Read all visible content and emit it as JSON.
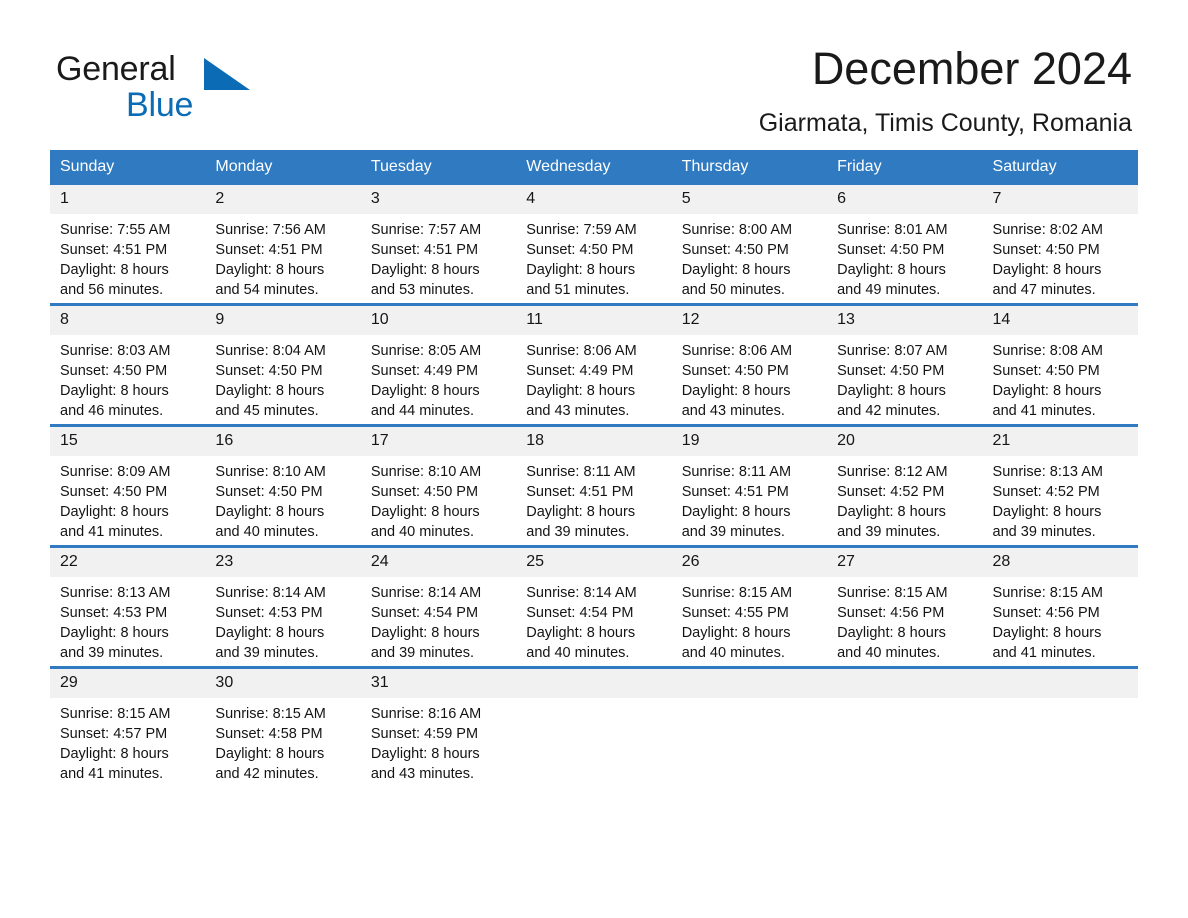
{
  "brand": {
    "name_part1": "General",
    "name_part2": "Blue",
    "flag_icon": "triangle-flag-icon"
  },
  "header": {
    "title": "December 2024",
    "subtitle": "Giarmata, Timis County, Romania"
  },
  "colors": {
    "header_blue": "#2f7ac0",
    "brand_blue": "#0b6cb5",
    "daynum_band": "#f1f1f1",
    "text": "#141414"
  },
  "weekday_headers": [
    "Sunday",
    "Monday",
    "Tuesday",
    "Wednesday",
    "Thursday",
    "Friday",
    "Saturday"
  ],
  "weeks": [
    [
      {
        "day": "1",
        "sunrise": "Sunrise: 7:55 AM",
        "sunset": "Sunset: 4:51 PM",
        "daylight_line1": "Daylight: 8 hours",
        "daylight_line2": "and 56 minutes."
      },
      {
        "day": "2",
        "sunrise": "Sunrise: 7:56 AM",
        "sunset": "Sunset: 4:51 PM",
        "daylight_line1": "Daylight: 8 hours",
        "daylight_line2": "and 54 minutes."
      },
      {
        "day": "3",
        "sunrise": "Sunrise: 7:57 AM",
        "sunset": "Sunset: 4:51 PM",
        "daylight_line1": "Daylight: 8 hours",
        "daylight_line2": "and 53 minutes."
      },
      {
        "day": "4",
        "sunrise": "Sunrise: 7:59 AM",
        "sunset": "Sunset: 4:50 PM",
        "daylight_line1": "Daylight: 8 hours",
        "daylight_line2": "and 51 minutes."
      },
      {
        "day": "5",
        "sunrise": "Sunrise: 8:00 AM",
        "sunset": "Sunset: 4:50 PM",
        "daylight_line1": "Daylight: 8 hours",
        "daylight_line2": "and 50 minutes."
      },
      {
        "day": "6",
        "sunrise": "Sunrise: 8:01 AM",
        "sunset": "Sunset: 4:50 PM",
        "daylight_line1": "Daylight: 8 hours",
        "daylight_line2": "and 49 minutes."
      },
      {
        "day": "7",
        "sunrise": "Sunrise: 8:02 AM",
        "sunset": "Sunset: 4:50 PM",
        "daylight_line1": "Daylight: 8 hours",
        "daylight_line2": "and 47 minutes."
      }
    ],
    [
      {
        "day": "8",
        "sunrise": "Sunrise: 8:03 AM",
        "sunset": "Sunset: 4:50 PM",
        "daylight_line1": "Daylight: 8 hours",
        "daylight_line2": "and 46 minutes."
      },
      {
        "day": "9",
        "sunrise": "Sunrise: 8:04 AM",
        "sunset": "Sunset: 4:50 PM",
        "daylight_line1": "Daylight: 8 hours",
        "daylight_line2": "and 45 minutes."
      },
      {
        "day": "10",
        "sunrise": "Sunrise: 8:05 AM",
        "sunset": "Sunset: 4:49 PM",
        "daylight_line1": "Daylight: 8 hours",
        "daylight_line2": "and 44 minutes."
      },
      {
        "day": "11",
        "sunrise": "Sunrise: 8:06 AM",
        "sunset": "Sunset: 4:49 PM",
        "daylight_line1": "Daylight: 8 hours",
        "daylight_line2": "and 43 minutes."
      },
      {
        "day": "12",
        "sunrise": "Sunrise: 8:06 AM",
        "sunset": "Sunset: 4:50 PM",
        "daylight_line1": "Daylight: 8 hours",
        "daylight_line2": "and 43 minutes."
      },
      {
        "day": "13",
        "sunrise": "Sunrise: 8:07 AM",
        "sunset": "Sunset: 4:50 PM",
        "daylight_line1": "Daylight: 8 hours",
        "daylight_line2": "and 42 minutes."
      },
      {
        "day": "14",
        "sunrise": "Sunrise: 8:08 AM",
        "sunset": "Sunset: 4:50 PM",
        "daylight_line1": "Daylight: 8 hours",
        "daylight_line2": "and 41 minutes."
      }
    ],
    [
      {
        "day": "15",
        "sunrise": "Sunrise: 8:09 AM",
        "sunset": "Sunset: 4:50 PM",
        "daylight_line1": "Daylight: 8 hours",
        "daylight_line2": "and 41 minutes."
      },
      {
        "day": "16",
        "sunrise": "Sunrise: 8:10 AM",
        "sunset": "Sunset: 4:50 PM",
        "daylight_line1": "Daylight: 8 hours",
        "daylight_line2": "and 40 minutes."
      },
      {
        "day": "17",
        "sunrise": "Sunrise: 8:10 AM",
        "sunset": "Sunset: 4:50 PM",
        "daylight_line1": "Daylight: 8 hours",
        "daylight_line2": "and 40 minutes."
      },
      {
        "day": "18",
        "sunrise": "Sunrise: 8:11 AM",
        "sunset": "Sunset: 4:51 PM",
        "daylight_line1": "Daylight: 8 hours",
        "daylight_line2": "and 39 minutes."
      },
      {
        "day": "19",
        "sunrise": "Sunrise: 8:11 AM",
        "sunset": "Sunset: 4:51 PM",
        "daylight_line1": "Daylight: 8 hours",
        "daylight_line2": "and 39 minutes."
      },
      {
        "day": "20",
        "sunrise": "Sunrise: 8:12 AM",
        "sunset": "Sunset: 4:52 PM",
        "daylight_line1": "Daylight: 8 hours",
        "daylight_line2": "and 39 minutes."
      },
      {
        "day": "21",
        "sunrise": "Sunrise: 8:13 AM",
        "sunset": "Sunset: 4:52 PM",
        "daylight_line1": "Daylight: 8 hours",
        "daylight_line2": "and 39 minutes."
      }
    ],
    [
      {
        "day": "22",
        "sunrise": "Sunrise: 8:13 AM",
        "sunset": "Sunset: 4:53 PM",
        "daylight_line1": "Daylight: 8 hours",
        "daylight_line2": "and 39 minutes."
      },
      {
        "day": "23",
        "sunrise": "Sunrise: 8:14 AM",
        "sunset": "Sunset: 4:53 PM",
        "daylight_line1": "Daylight: 8 hours",
        "daylight_line2": "and 39 minutes."
      },
      {
        "day": "24",
        "sunrise": "Sunrise: 8:14 AM",
        "sunset": "Sunset: 4:54 PM",
        "daylight_line1": "Daylight: 8 hours",
        "daylight_line2": "and 39 minutes."
      },
      {
        "day": "25",
        "sunrise": "Sunrise: 8:14 AM",
        "sunset": "Sunset: 4:54 PM",
        "daylight_line1": "Daylight: 8 hours",
        "daylight_line2": "and 40 minutes."
      },
      {
        "day": "26",
        "sunrise": "Sunrise: 8:15 AM",
        "sunset": "Sunset: 4:55 PM",
        "daylight_line1": "Daylight: 8 hours",
        "daylight_line2": "and 40 minutes."
      },
      {
        "day": "27",
        "sunrise": "Sunrise: 8:15 AM",
        "sunset": "Sunset: 4:56 PM",
        "daylight_line1": "Daylight: 8 hours",
        "daylight_line2": "and 40 minutes."
      },
      {
        "day": "28",
        "sunrise": "Sunrise: 8:15 AM",
        "sunset": "Sunset: 4:56 PM",
        "daylight_line1": "Daylight: 8 hours",
        "daylight_line2": "and 41 minutes."
      }
    ],
    [
      {
        "day": "29",
        "sunrise": "Sunrise: 8:15 AM",
        "sunset": "Sunset: 4:57 PM",
        "daylight_line1": "Daylight: 8 hours",
        "daylight_line2": "and 41 minutes."
      },
      {
        "day": "30",
        "sunrise": "Sunrise: 8:15 AM",
        "sunset": "Sunset: 4:58 PM",
        "daylight_line1": "Daylight: 8 hours",
        "daylight_line2": "and 42 minutes."
      },
      {
        "day": "31",
        "sunrise": "Sunrise: 8:16 AM",
        "sunset": "Sunset: 4:59 PM",
        "daylight_line1": "Daylight: 8 hours",
        "daylight_line2": "and 43 minutes."
      },
      {
        "day": "",
        "sunrise": "",
        "sunset": "",
        "daylight_line1": "",
        "daylight_line2": ""
      },
      {
        "day": "",
        "sunrise": "",
        "sunset": "",
        "daylight_line1": "",
        "daylight_line2": ""
      },
      {
        "day": "",
        "sunrise": "",
        "sunset": "",
        "daylight_line1": "",
        "daylight_line2": ""
      },
      {
        "day": "",
        "sunrise": "",
        "sunset": "",
        "daylight_line1": "",
        "daylight_line2": ""
      }
    ]
  ]
}
